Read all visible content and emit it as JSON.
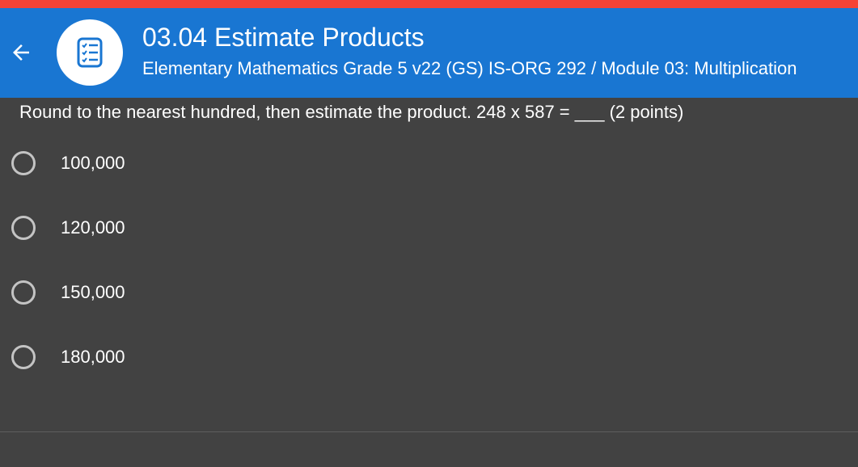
{
  "header": {
    "title": "03.04 Estimate Products",
    "subtitle": "Elementary Mathematics Grade 5 v22 (GS) IS-ORG 292 / Module 03: Multiplication",
    "back_icon": "arrow-left-icon",
    "avatar_icon": "checklist-icon",
    "bar_color": "#1976d2",
    "strip_color": "#f44336"
  },
  "question": {
    "text": "Round to the nearest hundred, then estimate the product. 248 x 587 = ___ (2 points)"
  },
  "options": [
    {
      "label": "100,000",
      "selected": false
    },
    {
      "label": "120,000",
      "selected": false
    },
    {
      "label": "150,000",
      "selected": false
    },
    {
      "label": "180,000",
      "selected": false
    }
  ],
  "colors": {
    "background": "#424242",
    "text": "#ffffff",
    "radio_border": "#c4c4c4"
  }
}
